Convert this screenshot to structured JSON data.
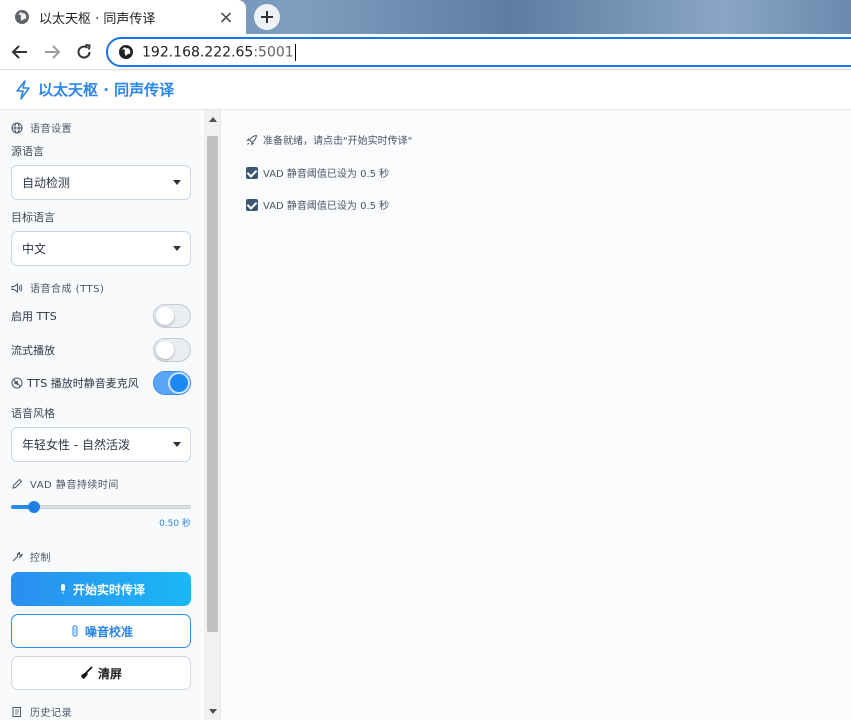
{
  "browser": {
    "tab_title": "以太天枢 · 同声传译",
    "tab_close": "×",
    "url_host": "192.168.222.65",
    "url_port": ":5001"
  },
  "header": {
    "title": "以太天枢 · 同声传译"
  },
  "sidebar": {
    "language_section": "语音设置",
    "source_label": "源语言",
    "source_value": "自动检测",
    "target_label": "目标语言",
    "target_value": "中文",
    "tts_section": "语音合成 (TTS)",
    "enable_tts_label": "启用 TTS",
    "enable_tts_on": false,
    "stream_label": "流式播放",
    "stream_on": false,
    "mute_label": "TTS 播放时静音麦克风",
    "mute_on": true,
    "voice_style_label": "语音风格",
    "voice_style_value": "年轻女性 - 自然活泼",
    "vad_section": "VAD 静音持续时间",
    "vad_value": 0.5,
    "vad_value_text": "0.50 秒",
    "control_section": "控制",
    "start_button": "开始实时传译",
    "calibrate_button": "噪音校准",
    "clear_button": "清屏",
    "history_section": "历史记录"
  },
  "main": {
    "status_text": "准备就绪，请点击\"开始实时传译\"",
    "log": [
      "VAD 静音阈值已设为 0.5 秒",
      "VAD 静音阈值已设为 0.5 秒"
    ]
  },
  "colors": {
    "accent": "#2b8ef0",
    "title": "#2a86e8"
  }
}
